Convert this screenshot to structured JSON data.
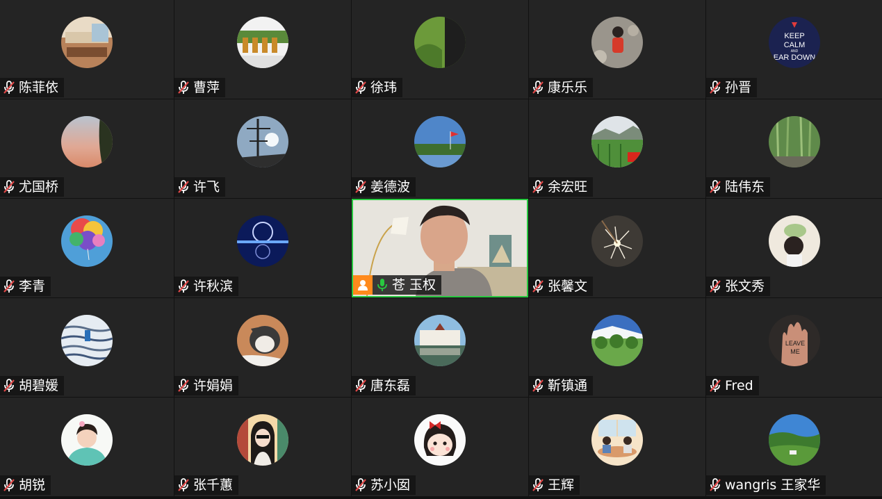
{
  "colors": {
    "tile_bg": "#242424",
    "active_border": "#28c840",
    "mic_muted_icon": "#ffffff",
    "mic_active_icon": "#28c840",
    "host_badge": "#ff8a1c"
  },
  "participants": [
    {
      "name": "陈菲依",
      "mic": "muted-mic-icon"
    },
    {
      "name": "曹萍",
      "mic": "muted-mic-icon"
    },
    {
      "name": "徐玮",
      "mic": "muted-mic-icon"
    },
    {
      "name": "康乐乐",
      "mic": "muted-mic-icon"
    },
    {
      "name": "孙晋",
      "mic": "muted-mic-icon",
      "avatar_text": [
        "KEEP",
        "CALM",
        "AND",
        "EAR DOWN"
      ]
    },
    {
      "name": "尤国桥",
      "mic": "muted-mic-icon"
    },
    {
      "name": "许飞",
      "mic": "muted-mic-icon"
    },
    {
      "name": "姜德波",
      "mic": "muted-mic-icon"
    },
    {
      "name": "余宏旺",
      "mic": "muted-mic-icon"
    },
    {
      "name": "陆伟东",
      "mic": "muted-mic-icon"
    },
    {
      "name": "李青",
      "mic": "muted-mic-icon"
    },
    {
      "name": "许秋滨",
      "mic": "muted-mic-icon"
    },
    {
      "name": "苍 玉权",
      "mic": "active-mic-icon",
      "speaking": true,
      "badge": "person-icon"
    },
    {
      "name": "张馨文",
      "mic": "muted-mic-icon"
    },
    {
      "name": "张文秀",
      "mic": "muted-mic-icon"
    },
    {
      "name": "胡碧媛",
      "mic": "muted-mic-icon"
    },
    {
      "name": "许娟娟",
      "mic": "muted-mic-icon"
    },
    {
      "name": "唐东磊",
      "mic": "muted-mic-icon"
    },
    {
      "name": "靳镇通",
      "mic": "muted-mic-icon"
    },
    {
      "name": "Fred",
      "mic": "muted-mic-icon",
      "avatar_text": [
        "LEAVE",
        "ME"
      ]
    },
    {
      "name": "胡锐",
      "mic": "muted-mic-icon"
    },
    {
      "name": "张千蕙",
      "mic": "muted-mic-icon"
    },
    {
      "name": "苏小囡",
      "mic": "muted-mic-icon"
    },
    {
      "name": "王辉",
      "mic": "muted-mic-icon"
    },
    {
      "name": "wangris 王家华",
      "mic": "muted-mic-icon"
    }
  ]
}
